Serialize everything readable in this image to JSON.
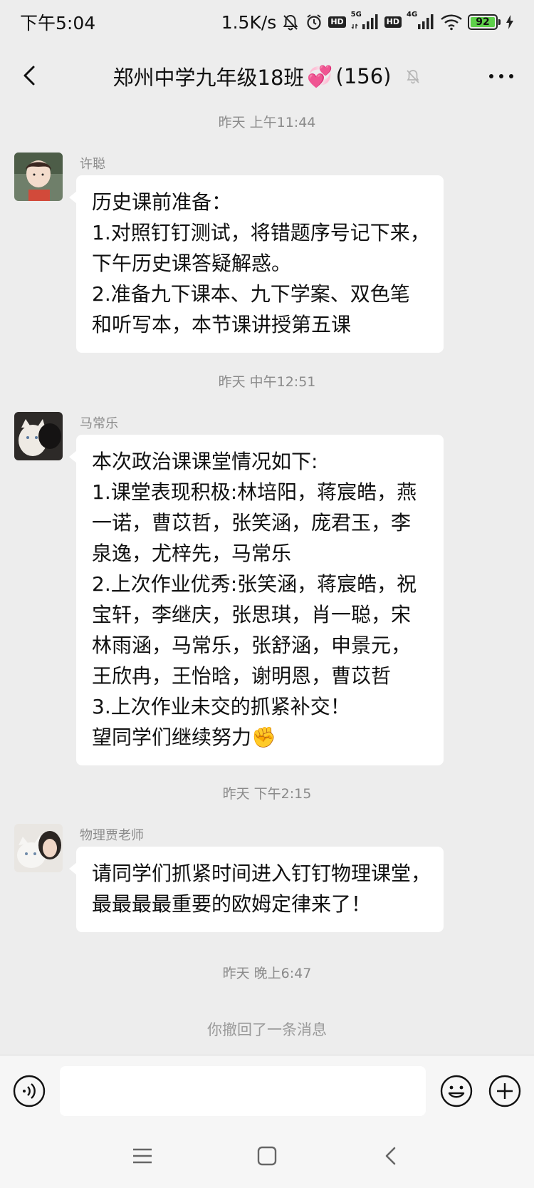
{
  "status_bar": {
    "time": "下午5:04",
    "speed": "1.5K/s",
    "hd1": "HD",
    "net1": "5G",
    "hd2": "HD",
    "net2": "4G",
    "battery": "92",
    "icons": [
      "bell-off-icon",
      "alarm-icon",
      "signal-icon",
      "wifi-icon",
      "battery-icon",
      "charging-icon"
    ]
  },
  "header": {
    "title": "郑州中学九年级18班",
    "title_emoji": "💞",
    "member_count": "(156)"
  },
  "messages": [
    {
      "time": "昨天 上午11:44",
      "sender": "许聪",
      "lines": [
        "历史课前准备：",
        "1.对照钉钉测试，将错题序号记下来，",
        "下午历史课答疑解惑。",
        "2.准备九下课本、九下学案、双色笔",
        "和听写本，本节课讲授第五课"
      ]
    },
    {
      "time": "昨天 中午12:51",
      "sender": "马常乐",
      "lines": [
        "本次政治课课堂情况如下:",
        "1.课堂表现积极:林培阳，蒋宸皓，燕",
        "一诺，曹苡哲，张笑涵，庞君玉，李",
        "泉逸，尤梓先，马常乐",
        "2.上次作业优秀:张笑涵，蒋宸皓，祝",
        "宝轩，李继庆，张思琪，肖一聪，宋",
        "林雨涵，马常乐，张舒涵，申景元，",
        "王欣冉，王怡晗，谢明恩，曹苡哲",
        "3.上次作业未交的抓紧补交！",
        "望同学们继续努力✊"
      ]
    },
    {
      "time": "昨天 下午2:15",
      "sender": "物理贾老师",
      "lines": [
        "请同学们抓紧时间进入钉钉物理课堂，",
        "最最最最重要的欧姆定律来了！"
      ]
    }
  ],
  "last_time": "昨天 晚上6:47",
  "recall_notice": "你撤回了一条消息",
  "colors": {
    "background": "#ededed",
    "bubble": "#ffffff",
    "battery_fill": "#5ed04a"
  }
}
